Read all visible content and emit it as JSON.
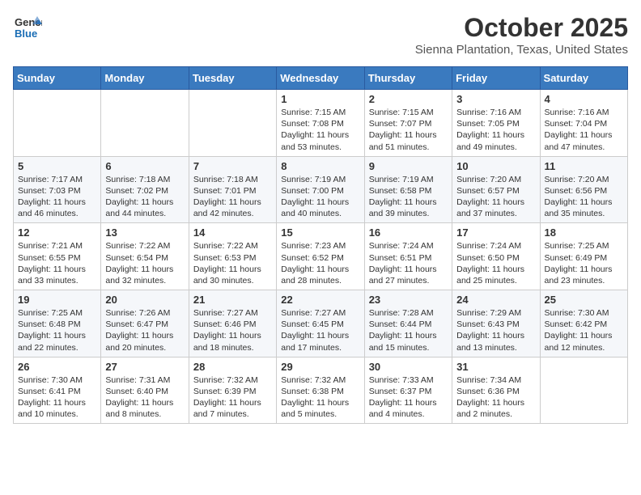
{
  "header": {
    "logo_general": "General",
    "logo_blue": "Blue",
    "month": "October 2025",
    "location": "Sienna Plantation, Texas, United States"
  },
  "days_of_week": [
    "Sunday",
    "Monday",
    "Tuesday",
    "Wednesday",
    "Thursday",
    "Friday",
    "Saturday"
  ],
  "weeks": [
    [
      {
        "day": "",
        "content": ""
      },
      {
        "day": "",
        "content": ""
      },
      {
        "day": "",
        "content": ""
      },
      {
        "day": "1",
        "content": "Sunrise: 7:15 AM\nSunset: 7:08 PM\nDaylight: 11 hours and 53 minutes."
      },
      {
        "day": "2",
        "content": "Sunrise: 7:15 AM\nSunset: 7:07 PM\nDaylight: 11 hours and 51 minutes."
      },
      {
        "day": "3",
        "content": "Sunrise: 7:16 AM\nSunset: 7:05 PM\nDaylight: 11 hours and 49 minutes."
      },
      {
        "day": "4",
        "content": "Sunrise: 7:16 AM\nSunset: 7:04 PM\nDaylight: 11 hours and 47 minutes."
      }
    ],
    [
      {
        "day": "5",
        "content": "Sunrise: 7:17 AM\nSunset: 7:03 PM\nDaylight: 11 hours and 46 minutes."
      },
      {
        "day": "6",
        "content": "Sunrise: 7:18 AM\nSunset: 7:02 PM\nDaylight: 11 hours and 44 minutes."
      },
      {
        "day": "7",
        "content": "Sunrise: 7:18 AM\nSunset: 7:01 PM\nDaylight: 11 hours and 42 minutes."
      },
      {
        "day": "8",
        "content": "Sunrise: 7:19 AM\nSunset: 7:00 PM\nDaylight: 11 hours and 40 minutes."
      },
      {
        "day": "9",
        "content": "Sunrise: 7:19 AM\nSunset: 6:58 PM\nDaylight: 11 hours and 39 minutes."
      },
      {
        "day": "10",
        "content": "Sunrise: 7:20 AM\nSunset: 6:57 PM\nDaylight: 11 hours and 37 minutes."
      },
      {
        "day": "11",
        "content": "Sunrise: 7:20 AM\nSunset: 6:56 PM\nDaylight: 11 hours and 35 minutes."
      }
    ],
    [
      {
        "day": "12",
        "content": "Sunrise: 7:21 AM\nSunset: 6:55 PM\nDaylight: 11 hours and 33 minutes."
      },
      {
        "day": "13",
        "content": "Sunrise: 7:22 AM\nSunset: 6:54 PM\nDaylight: 11 hours and 32 minutes."
      },
      {
        "day": "14",
        "content": "Sunrise: 7:22 AM\nSunset: 6:53 PM\nDaylight: 11 hours and 30 minutes."
      },
      {
        "day": "15",
        "content": "Sunrise: 7:23 AM\nSunset: 6:52 PM\nDaylight: 11 hours and 28 minutes."
      },
      {
        "day": "16",
        "content": "Sunrise: 7:24 AM\nSunset: 6:51 PM\nDaylight: 11 hours and 27 minutes."
      },
      {
        "day": "17",
        "content": "Sunrise: 7:24 AM\nSunset: 6:50 PM\nDaylight: 11 hours and 25 minutes."
      },
      {
        "day": "18",
        "content": "Sunrise: 7:25 AM\nSunset: 6:49 PM\nDaylight: 11 hours and 23 minutes."
      }
    ],
    [
      {
        "day": "19",
        "content": "Sunrise: 7:25 AM\nSunset: 6:48 PM\nDaylight: 11 hours and 22 minutes."
      },
      {
        "day": "20",
        "content": "Sunrise: 7:26 AM\nSunset: 6:47 PM\nDaylight: 11 hours and 20 minutes."
      },
      {
        "day": "21",
        "content": "Sunrise: 7:27 AM\nSunset: 6:46 PM\nDaylight: 11 hours and 18 minutes."
      },
      {
        "day": "22",
        "content": "Sunrise: 7:27 AM\nSunset: 6:45 PM\nDaylight: 11 hours and 17 minutes."
      },
      {
        "day": "23",
        "content": "Sunrise: 7:28 AM\nSunset: 6:44 PM\nDaylight: 11 hours and 15 minutes."
      },
      {
        "day": "24",
        "content": "Sunrise: 7:29 AM\nSunset: 6:43 PM\nDaylight: 11 hours and 13 minutes."
      },
      {
        "day": "25",
        "content": "Sunrise: 7:30 AM\nSunset: 6:42 PM\nDaylight: 11 hours and 12 minutes."
      }
    ],
    [
      {
        "day": "26",
        "content": "Sunrise: 7:30 AM\nSunset: 6:41 PM\nDaylight: 11 hours and 10 minutes."
      },
      {
        "day": "27",
        "content": "Sunrise: 7:31 AM\nSunset: 6:40 PM\nDaylight: 11 hours and 8 minutes."
      },
      {
        "day": "28",
        "content": "Sunrise: 7:32 AM\nSunset: 6:39 PM\nDaylight: 11 hours and 7 minutes."
      },
      {
        "day": "29",
        "content": "Sunrise: 7:32 AM\nSunset: 6:38 PM\nDaylight: 11 hours and 5 minutes."
      },
      {
        "day": "30",
        "content": "Sunrise: 7:33 AM\nSunset: 6:37 PM\nDaylight: 11 hours and 4 minutes."
      },
      {
        "day": "31",
        "content": "Sunrise: 7:34 AM\nSunset: 6:36 PM\nDaylight: 11 hours and 2 minutes."
      },
      {
        "day": "",
        "content": ""
      }
    ]
  ]
}
